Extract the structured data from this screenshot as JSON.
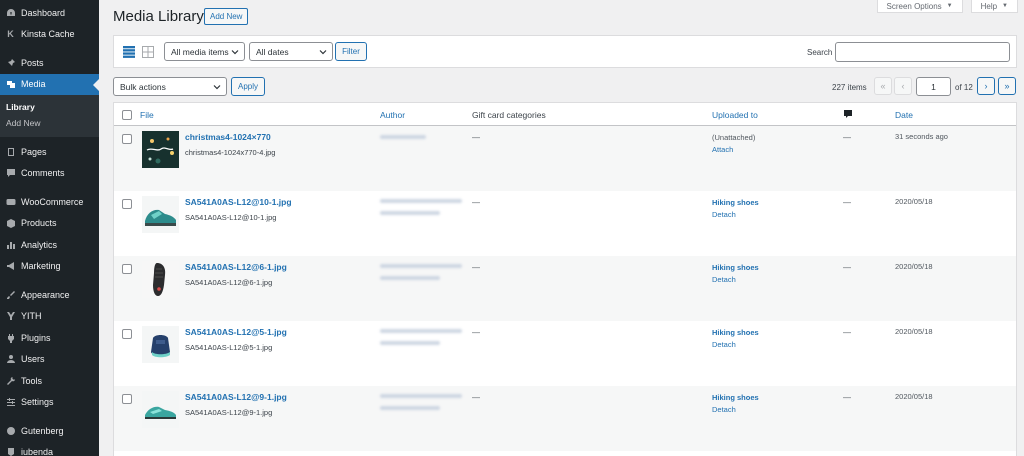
{
  "sidebar": {
    "items": [
      {
        "label": "Dashboard",
        "icon": "dashboard-icon"
      },
      {
        "label": "Kinsta Cache",
        "icon": "kinsta-icon"
      },
      {
        "label": "Posts",
        "icon": "pin-icon"
      },
      {
        "label": "Media",
        "icon": "media-icon"
      },
      {
        "label": "Pages",
        "icon": "pages-icon"
      },
      {
        "label": "Comments",
        "icon": "comments-icon"
      },
      {
        "label": "WooCommerce",
        "icon": "woocommerce-icon"
      },
      {
        "label": "Products",
        "icon": "products-icon"
      },
      {
        "label": "Analytics",
        "icon": "analytics-icon"
      },
      {
        "label": "Marketing",
        "icon": "megaphone-icon"
      },
      {
        "label": "Appearance",
        "icon": "brush-icon"
      },
      {
        "label": "YITH",
        "icon": "yith-icon"
      },
      {
        "label": "Plugins",
        "icon": "plugin-icon"
      },
      {
        "label": "Users",
        "icon": "users-icon"
      },
      {
        "label": "Tools",
        "icon": "wrench-icon"
      },
      {
        "label": "Settings",
        "icon": "settings-icon"
      },
      {
        "label": "Gutenberg",
        "icon": "gutenberg-icon"
      },
      {
        "label": "iubenda",
        "icon": "iubenda-icon"
      }
    ],
    "submenu": [
      "Library",
      "Add New"
    ]
  },
  "screen_options": {
    "label": "Screen Options"
  },
  "help": {
    "label": "Help"
  },
  "header": {
    "title": "Media Library",
    "add_new": "Add New"
  },
  "filters": {
    "media_type": "All media items",
    "dates": "All dates",
    "filter_button": "Filter",
    "search_label": "Search"
  },
  "bulk": {
    "select": "Bulk actions",
    "apply": "Apply"
  },
  "pagination": {
    "items": "227 items",
    "first": "«",
    "prev": "‹",
    "current": "1",
    "of": "of 12",
    "next": "›",
    "last": "»"
  },
  "table": {
    "columns": {
      "file": "File",
      "author": "Author",
      "gift": "Gift card categories",
      "uploaded_to": "Uploaded to",
      "date": "Date"
    },
    "rows": [
      {
        "title": "christmas4-1024×770",
        "filename": "christmas4-1024x770-4.jpg",
        "gift": "—",
        "uploaded": "(Unattached)",
        "action": "Attach",
        "comments": "—",
        "date": "31 seconds ago"
      },
      {
        "title": "SA541A0AS-L12@10-1.jpg",
        "filename": "SA541A0AS-L12@10-1.jpg",
        "gift": "—",
        "uploaded": "Hiking shoes",
        "action": "Detach",
        "comments": "—",
        "date": "2020/05/18"
      },
      {
        "title": "SA541A0AS-L12@6-1.jpg",
        "filename": "SA541A0AS-L12@6-1.jpg",
        "gift": "—",
        "uploaded": "Hiking shoes",
        "action": "Detach",
        "comments": "—",
        "date": "2020/05/18"
      },
      {
        "title": "SA541A0AS-L12@5-1.jpg",
        "filename": "SA541A0AS-L12@5-1.jpg",
        "gift": "—",
        "uploaded": "Hiking shoes",
        "action": "Detach",
        "comments": "—",
        "date": "2020/05/18"
      },
      {
        "title": "SA541A0AS-L12@9-1.jpg",
        "filename": "SA541A0AS-L12@9-1.jpg",
        "gift": "—",
        "uploaded": "Hiking shoes",
        "action": "Detach",
        "comments": "—",
        "date": "2020/05/18"
      }
    ]
  },
  "colors": {
    "accent": "#2271b1",
    "sidebar_bg": "#1d2327",
    "active_bg": "#2271b1"
  }
}
